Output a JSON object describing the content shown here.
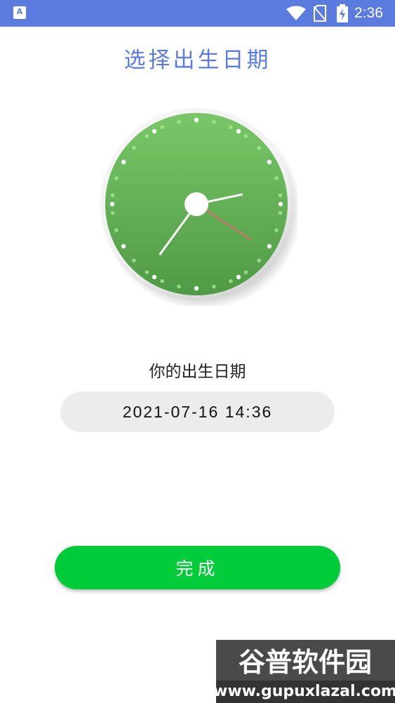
{
  "status_bar": {
    "time": "2:36",
    "app_icon": "A",
    "icons": [
      "app-notification-icon",
      "wifi-icon",
      "no-sim-icon",
      "battery-charging-icon"
    ],
    "color": "#5b7bdf"
  },
  "page": {
    "title": "选择出生日期"
  },
  "clock": {
    "icon": "analog-clock-icon",
    "face_color": "#5fad54",
    "hour": 2,
    "minute": 36
  },
  "birth": {
    "label": "你的出生日期",
    "value": "2021-07-16 14:36"
  },
  "actions": {
    "done_label": "完成",
    "done_color": "#00cc39"
  },
  "watermark": {
    "brand": "谷普软件园",
    "url": "www.gupuxlazal.com"
  }
}
